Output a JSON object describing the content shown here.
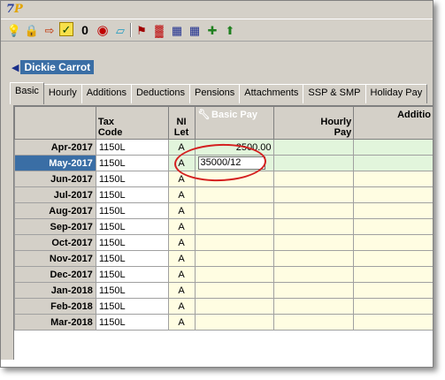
{
  "app": {
    "icon_text": "Pay"
  },
  "toolbar": {
    "icons": [
      "help-icon",
      "lock-icon",
      "import-icon",
      "approve-icon",
      "zero-icon",
      "target-icon",
      "eraser-icon",
      "flag-icon",
      "bar-chart-icon",
      "calendar-icon",
      "add-payslip-icon"
    ]
  },
  "employee": {
    "name": "Dickie Carrot"
  },
  "tabs": [
    "Basic",
    "Hourly",
    "Additions",
    "Deductions",
    "Pensions",
    "Attachments",
    "SSP & SMP",
    "Holiday Pay"
  ],
  "active_tab": "Basic",
  "grid": {
    "columns": [
      "Tax\nCode",
      "NI\nLet",
      "Basic Pay",
      "Hourly\nPay",
      "Additio"
    ],
    "rows": [
      {
        "period": "Apr-2017",
        "tax": "1150L",
        "ni": "A",
        "basic": "2500.00",
        "state": "cur"
      },
      {
        "period": "May-2017",
        "tax": "1150L",
        "ni": "A",
        "basic": "35000/12",
        "state": "editing"
      },
      {
        "period": "Jun-2017",
        "tax": "1150L",
        "ni": "A",
        "basic": "",
        "state": "fut"
      },
      {
        "period": "Jul-2017",
        "tax": "1150L",
        "ni": "A",
        "basic": "",
        "state": "fut"
      },
      {
        "period": "Aug-2017",
        "tax": "1150L",
        "ni": "A",
        "basic": "",
        "state": "fut"
      },
      {
        "period": "Sep-2017",
        "tax": "1150L",
        "ni": "A",
        "basic": "",
        "state": "fut"
      },
      {
        "period": "Oct-2017",
        "tax": "1150L",
        "ni": "A",
        "basic": "",
        "state": "fut"
      },
      {
        "period": "Nov-2017",
        "tax": "1150L",
        "ni": "A",
        "basic": "",
        "state": "fut"
      },
      {
        "period": "Dec-2017",
        "tax": "1150L",
        "ni": "A",
        "basic": "",
        "state": "fut"
      },
      {
        "period": "Jan-2018",
        "tax": "1150L",
        "ni": "A",
        "basic": "",
        "state": "fut"
      },
      {
        "period": "Feb-2018",
        "tax": "1150L",
        "ni": "A",
        "basic": "",
        "state": "fut"
      },
      {
        "period": "Mar-2018",
        "tax": "1150L",
        "ni": "A",
        "basic": "",
        "state": "fut"
      }
    ]
  },
  "colors": {
    "selection": "#3a6ea5",
    "current_row": "#e2f5dc",
    "future_row": "#fffde2",
    "ring": "#d42020"
  }
}
